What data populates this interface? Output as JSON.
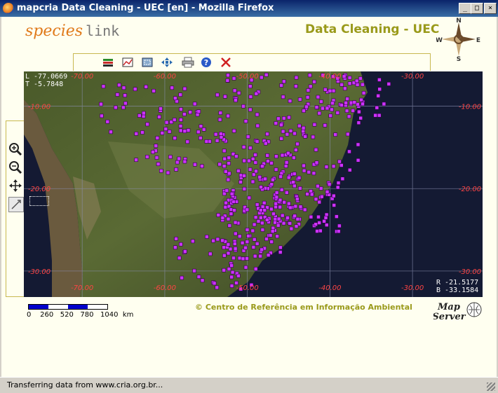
{
  "window": {
    "title": "mapcria Data Cleaning - UEC [en] - Mozilla Firefox",
    "minimize": "_",
    "maximize": "□",
    "close": "×"
  },
  "header": {
    "logo_species": "species",
    "logo_link": "link",
    "title": "Data Cleaning - UEC",
    "compass": {
      "n": "N",
      "s": "S",
      "e": "E",
      "w": "W"
    }
  },
  "toolbar": {
    "icons": [
      "layers-icon",
      "chart-icon",
      "select-area-icon",
      "move-icon",
      "print-icon",
      "help-icon",
      "close-icon"
    ]
  },
  "sidetools": {
    "icons": [
      "zoom-in-icon",
      "zoom-out-icon",
      "pan-icon",
      "select-point-icon"
    ]
  },
  "map": {
    "coords_top_left": {
      "l": "L -77.0669",
      "t": "T -5.7848"
    },
    "coords_bottom_right": {
      "r": "R -21.5177",
      "b": "B -33.1584"
    },
    "lon_labels": [
      "-70.00",
      "-60.00",
      "-50.00",
      "-40.00",
      "-30.00"
    ],
    "lat_labels": [
      "-10.00",
      "-20.00",
      "-30.00"
    ],
    "point_color": "#cc33ff",
    "label_color": "#ff4444"
  },
  "scale": {
    "labels": [
      "0",
      "260",
      "520",
      "780",
      "1040",
      "km"
    ]
  },
  "footer": {
    "copyright": "© Centro de Referência em Informação Ambiental",
    "mapserver_line1": "Map",
    "mapserver_line2": "Server"
  },
  "status": {
    "text": "Transferring data from www.cria.org.br..."
  }
}
